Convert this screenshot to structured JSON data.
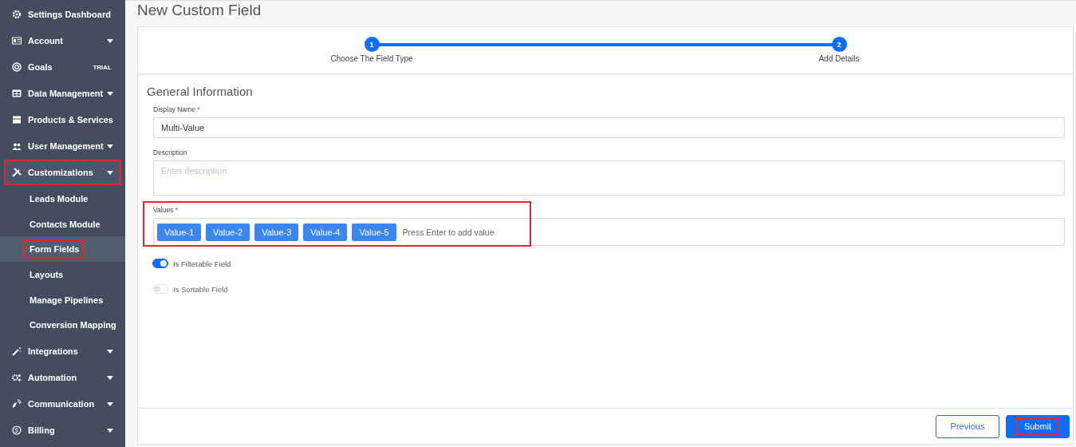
{
  "sidebar": {
    "items": [
      {
        "label": "Settings Dashboard",
        "expandable": false,
        "highlighted": false
      },
      {
        "label": "Account",
        "expandable": true,
        "highlighted": false
      },
      {
        "label": "Goals",
        "expandable": false,
        "badge": "TRIAL",
        "highlighted": false
      },
      {
        "label": "Data Management",
        "expandable": true,
        "highlighted": false
      },
      {
        "label": "Products & Services",
        "expandable": false,
        "highlighted": false
      },
      {
        "label": "User Management",
        "expandable": true,
        "highlighted": false
      },
      {
        "label": "Customizations",
        "expandable": true,
        "highlighted": true,
        "children": [
          {
            "label": "Leads Module",
            "selected": false,
            "highlighted": false
          },
          {
            "label": "Contacts Module",
            "selected": false,
            "highlighted": false
          },
          {
            "label": "Form Fields",
            "selected": true,
            "highlighted": true
          },
          {
            "label": "Layouts",
            "selected": false,
            "highlighted": false
          },
          {
            "label": "Manage Pipelines",
            "selected": false,
            "highlighted": false
          },
          {
            "label": "Conversion Mapping",
            "selected": false,
            "highlighted": false
          }
        ]
      },
      {
        "label": "Integrations",
        "expandable": true,
        "highlighted": false
      },
      {
        "label": "Automation",
        "expandable": true,
        "highlighted": false
      },
      {
        "label": "Communication",
        "expandable": true,
        "highlighted": false
      },
      {
        "label": "Billing",
        "expandable": true,
        "highlighted": false
      }
    ]
  },
  "page": {
    "title": "New Custom Field"
  },
  "stepper": {
    "steps": [
      {
        "number": "1",
        "label": "Choose The Field Type",
        "completed": true
      },
      {
        "number": "2",
        "label": "Add Details",
        "completed": true
      }
    ]
  },
  "form": {
    "section_title": "General Information",
    "display_name": {
      "label": "Display Name",
      "required_mark": "*",
      "value": "Multi-Value"
    },
    "description": {
      "label": "Description",
      "placeholder": "Enter description"
    },
    "values": {
      "label": "Values",
      "required_mark": "*",
      "tags": [
        "Value-1",
        "Value-2",
        "Value-3",
        "Value-4",
        "Value-5"
      ],
      "placeholder": "Press Enter to add value",
      "highlighted": true
    },
    "toggles": [
      {
        "label": "Is Filterable Field",
        "on": true,
        "disabled": false
      },
      {
        "label": "Is Sortable Field",
        "on": false,
        "disabled": true
      }
    ]
  },
  "buttons": [
    {
      "label": "Previous",
      "kind": "outline",
      "highlighted": false
    },
    {
      "label": "Submit",
      "kind": "primary",
      "highlighted": true
    }
  ]
}
